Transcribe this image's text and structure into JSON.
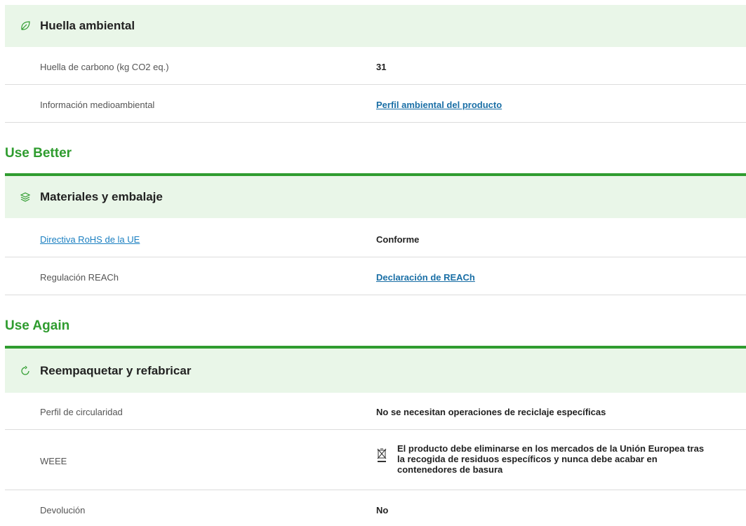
{
  "sections": {
    "footprint": {
      "icon": "leaf-icon",
      "title": "Huella ambiental",
      "rows": [
        {
          "label": "Huella de carbono (kg CO2 eq.)",
          "value": "31"
        },
        {
          "label": "Información medioambiental",
          "value": "Perfil ambiental del producto"
        }
      ]
    },
    "use_better": {
      "group_title": "Use Better",
      "icon": "layers-icon",
      "title": "Materiales y embalaje",
      "rows": [
        {
          "label": "Directiva RoHS de la UE",
          "value": "Conforme"
        },
        {
          "label": "Regulación REACh",
          "value": "Declaración de REACh"
        }
      ]
    },
    "use_again": {
      "group_title": "Use Again",
      "icon": "refresh-icon",
      "title": "Reempaquetar y refabricar",
      "rows": [
        {
          "label": "Perfil de circularidad",
          "value": "No se necesitan operaciones de reciclaje específicas"
        },
        {
          "label": "WEEE",
          "value": "El producto debe eliminarse en los mercados de la Unión Europea tras la recogida de residuos específicos y nunca debe acabar en contenedores de basura",
          "icon": "crossed-bin-icon"
        },
        {
          "label": "Devolución",
          "value": "No"
        }
      ]
    }
  },
  "colors": {
    "accent_green": "#2f9c2f",
    "header_bg": "#e9f6e8",
    "link_blue": "#1a6fa6"
  }
}
